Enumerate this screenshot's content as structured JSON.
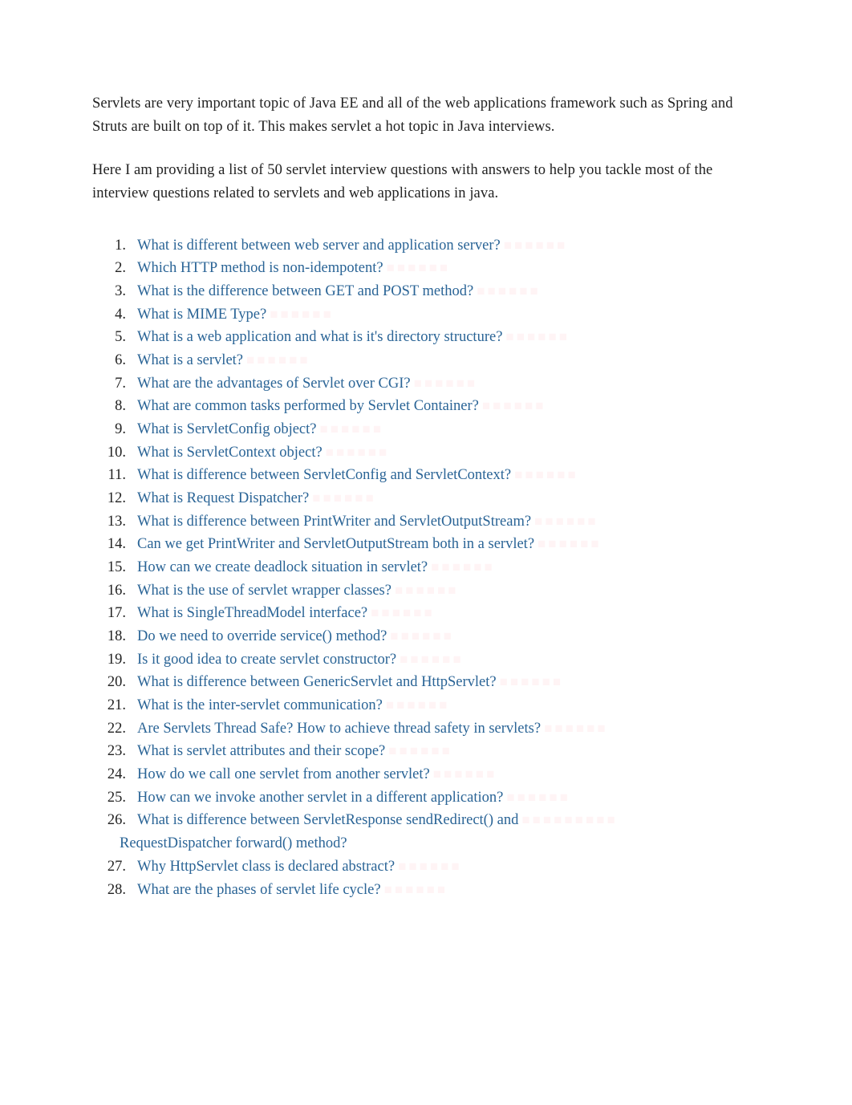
{
  "intro_p1": "Servlets are very important topic of Java EE and all of the web applications framework such as Spring and Struts are built on top of it. This makes servlet a hot topic in Java interviews.",
  "intro_p2": "Here I am providing a list of 50 servlet interview questions with answers to help you tackle most of the interview questions related to servlets and web applications in java.",
  "questions": [
    {
      "text": "What is different between web server and application server?"
    },
    {
      "text": "Which HTTP method is non-idempotent?"
    },
    {
      "text": "What is the difference between GET and POST method?"
    },
    {
      "text": "What is MIME Type?"
    },
    {
      "text": "What is a web application and what is it's directory structure?"
    },
    {
      "text": "What is a servlet?"
    },
    {
      "text": "What are the advantages of Servlet over CGI?"
    },
    {
      "text": "What are common tasks performed by Servlet Container?"
    },
    {
      "text": "What is ServletConfig object?"
    },
    {
      "text": "What is ServletContext object?"
    },
    {
      "text": "What is difference between ServletConfig and ServletContext?"
    },
    {
      "text": "What is Request Dispatcher?"
    },
    {
      "text": "What is difference between PrintWriter and ServletOutputStream?"
    },
    {
      "text": "Can we get PrintWriter and ServletOutputStream both in a servlet?"
    },
    {
      "text": "How can we create deadlock situation in servlet?"
    },
    {
      "text": "What is the use of servlet wrapper classes?"
    },
    {
      "text": "What is SingleThreadModel interface?"
    },
    {
      "text": "Do we need to override service() method?"
    },
    {
      "text": "Is it good idea to create servlet constructor?"
    },
    {
      "text": "What is difference between GenericServlet and HttpServlet?"
    },
    {
      "text": "What is the inter-servlet communication?"
    },
    {
      "text": "Are Servlets Thread Safe? How to achieve thread safety in servlets?"
    },
    {
      "text": "What is servlet attributes and their scope?"
    },
    {
      "text": "How do we call one servlet from another servlet?"
    },
    {
      "text": "How can we invoke another servlet in a different application?"
    },
    {
      "text": "What is difference between ServletResponse sendRedirect() and RequestDispatcher forward() method?",
      "multiline": true,
      "line1": "What is difference between ServletResponse sendRedirect() and",
      "line2": "RequestDispatcher forward() method?"
    },
    {
      "text": "Why HttpServlet class is declared abstract?"
    },
    {
      "text": "What are the phases of servlet life cycle?"
    }
  ]
}
